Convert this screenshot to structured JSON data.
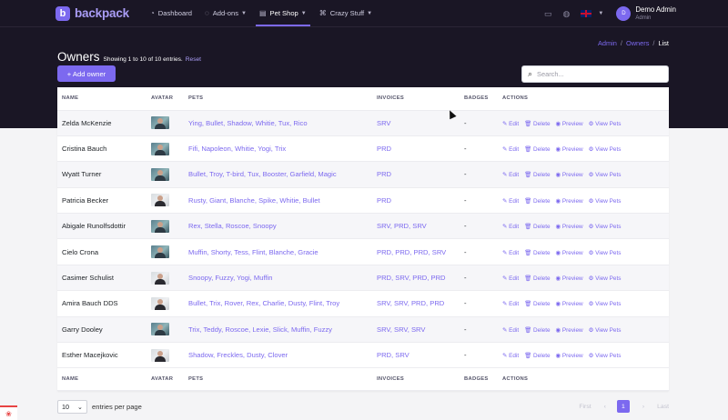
{
  "brand": {
    "logo_letter": "b",
    "name": "backpack"
  },
  "nav": [
    {
      "icon": "dashboard-icon",
      "glyph": "◔",
      "label": "Dashboard",
      "dropdown": false,
      "active": false
    },
    {
      "icon": "addons-icon",
      "glyph": "◌",
      "label": "Add-ons",
      "dropdown": true,
      "active": false
    },
    {
      "icon": "petshop-icon",
      "glyph": "▤",
      "label": "Pet Shop",
      "dropdown": true,
      "active": true
    },
    {
      "icon": "crazy-icon",
      "glyph": "⌘",
      "label": "Crazy Stuff",
      "dropdown": true,
      "active": false
    }
  ],
  "user": {
    "initial": "D",
    "name": "Demo Admin",
    "role": "Admin"
  },
  "breadcrumb": {
    "items": [
      "Admin",
      "Owners"
    ],
    "current": "List"
  },
  "page": {
    "title": "Owners",
    "subtitle": "Showing 1 to 10 of 10 entries.",
    "reset": "Reset"
  },
  "add_button": "+ Add owner",
  "search": {
    "placeholder": "Search..."
  },
  "columns": {
    "name": "NAME",
    "avatar": "AVATAR",
    "pets": "PETS",
    "invoices": "INVOICES",
    "badges": "BADGES",
    "actions": "ACTIONS"
  },
  "actions": {
    "edit": "Edit",
    "delete": "Delete",
    "preview": "Preview",
    "view_pets": "View Pets"
  },
  "rows": [
    {
      "name": "Zelda McKenzie",
      "avatar": "a",
      "pets": "Ying, Bullet, Shadow, Whitie, Tux, Rico",
      "invoices": "SRV",
      "badges": "-"
    },
    {
      "name": "Cristina Bauch",
      "avatar": "a",
      "pets": "Fifi, Napoleon, Whitie, Yogi, Trix",
      "invoices": "PRD",
      "badges": "-"
    },
    {
      "name": "Wyatt Turner",
      "avatar": "a",
      "pets": "Bullet, Troy, T-bird, Tux, Booster, Garfield, Magic",
      "invoices": "PRD",
      "badges": "-"
    },
    {
      "name": "Patricia Becker",
      "avatar": "b",
      "pets": "Rusty, Giant, Blanche, Spike, Whitie, Bullet",
      "invoices": "PRD",
      "badges": "-"
    },
    {
      "name": "Abigale Runolfsdottir",
      "avatar": "a",
      "pets": "Rex, Stella, Roscoe, Snoopy",
      "invoices": "SRV, PRD, SRV",
      "badges": "-"
    },
    {
      "name": "Cielo Crona",
      "avatar": "a",
      "pets": "Muffin, Shorty, Tess, Flint, Blanche, Gracie",
      "invoices": "PRD, PRD, PRD, SRV",
      "badges": "-"
    },
    {
      "name": "Casimer Schulist",
      "avatar": "b",
      "pets": "Snoopy, Fuzzy, Yogi, Muffin",
      "invoices": "PRD, SRV, PRD, PRD",
      "badges": "-"
    },
    {
      "name": "Amira Bauch DDS",
      "avatar": "b",
      "pets": "Bullet, Trix, Rover, Rex, Charlie, Dusty, Flint, Troy",
      "invoices": "SRV, SRV, PRD, PRD",
      "badges": "-"
    },
    {
      "name": "Garry Dooley",
      "avatar": "a",
      "pets": "Trix, Teddy, Roscoe, Lexie, Slick, Muffin, Fuzzy",
      "invoices": "SRV, SRV, SRV",
      "badges": "-"
    },
    {
      "name": "Esther Macejkovic",
      "avatar": "b",
      "pets": "Shadow, Freckles, Dusty, Clover",
      "invoices": "PRD, SRV",
      "badges": "-"
    }
  ],
  "per_page": {
    "value": "10",
    "label": "entries per page"
  },
  "pagination": {
    "first": "First",
    "prev": "‹",
    "page": "1",
    "next": "›",
    "last": "Last"
  },
  "colors": {
    "accent": "#7c69ef",
    "header_bg": "#1a1625"
  }
}
